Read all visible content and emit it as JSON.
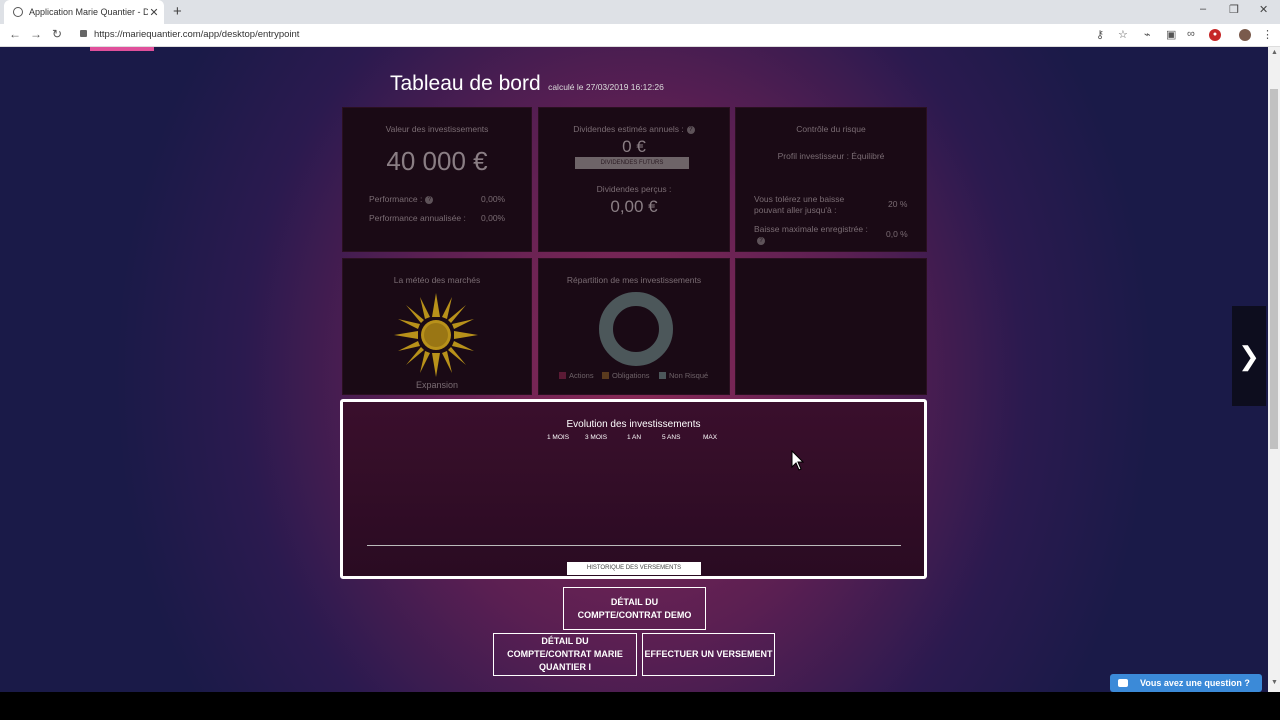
{
  "browser": {
    "tab_title": "Application Marie Quantier - De",
    "tab_close": "✕",
    "new_tab": "+",
    "url": "https://mariequantier.com/app/desktop/entrypoint"
  },
  "dashboard": {
    "title": "Tableau de bord",
    "computed": "calculé le 27/03/2019 16:12:26"
  },
  "investments": {
    "title": "Valeur des investissements",
    "value": "40 000 €",
    "performance_label": "Performance :",
    "performance_value": "0,00%",
    "annualized_label": "Performance annualisée :",
    "annualized_value": "0,00%"
  },
  "dividends": {
    "title": "Dividendes estimés annuels :",
    "estimated_value": "0 €",
    "future_button": "DIVIDENDES FUTURS",
    "received_label": "Dividendes perçus :",
    "received_value": "0,00 €"
  },
  "risk": {
    "title": "Contrôle du risque",
    "profile": "Profil investisseur : Équilibré",
    "tolerance_label": "Vous tolérez une baisse pouvant aller jusqu'à :",
    "tolerance_value": "20 %",
    "max_drop_label": "Baisse maximale enregistrée :",
    "max_drop_value": "0,0 %"
  },
  "weather": {
    "title": "La météo des marchés",
    "state": "Expansion"
  },
  "allocation": {
    "title": "Répartition de mes investissements",
    "legend": [
      {
        "label": "Actions",
        "color": "#5b1a35"
      },
      {
        "label": "Obligations",
        "color": "#5a3a1e"
      },
      {
        "label": "Non Risqué",
        "color": "#4c575a"
      }
    ]
  },
  "evolution": {
    "title": "Evolution des investissements",
    "periods": [
      "1 MOIS",
      "3 MOIS",
      "1 AN",
      "5 ANS",
      "MAX"
    ],
    "history_button": "HISTORIQUE DES VERSEMENTS"
  },
  "actions": {
    "detail_demo": "DÉTAIL DU COMPTE/CONTRAT DEMO",
    "detail_mq": "DÉTAIL DU COMPTE/CONTRAT MARIE QUANTIER I",
    "deposit": "EFFECTUER UN VERSEMENT"
  },
  "next_arrow": "❯",
  "chat": {
    "label": "Vous avez une question ?"
  },
  "colors": {
    "accent_pink": "#e0509b",
    "chat_blue": "#3b8ad8",
    "sun": "#b8911a"
  }
}
